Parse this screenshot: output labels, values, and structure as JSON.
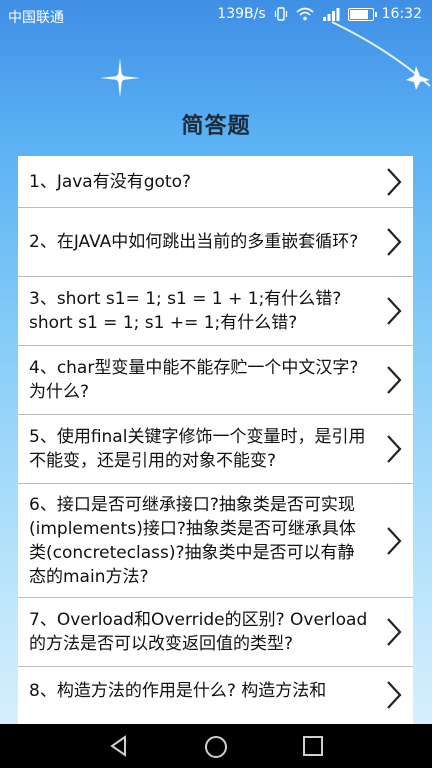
{
  "status_bar": {
    "carrier": "中国联通",
    "network_speed": "139B/s",
    "time": "16:32",
    "battery_level": 0.85,
    "icons": [
      "vibrate-icon",
      "wifi-icon",
      "signal-icon",
      "battery-icon"
    ]
  },
  "page": {
    "title": "简答题"
  },
  "questions": [
    {
      "text": "1、Java有没有goto?"
    },
    {
      "text": "2、在JAVA中如何跳出当前的多重嵌套循环?"
    },
    {
      "text": "3、short s1= 1; s1 = 1 + 1;有什么错? short s1 = 1; s1 += 1;有什么错?"
    },
    {
      "text": "4、char型变量中能不能存贮一个中文汉字?为什么?"
    },
    {
      "text": "5、使用final关键字修饰一个变量时，是引用不能变，还是引用的对象不能变?"
    },
    {
      "text": "6、接口是否可继承接口?抽象类是否可实现(implements)接口?抽象类是否可继承具体类(concreteclass)?抽象类中是否可以有静态的main方法?"
    },
    {
      "text": "7、Overload和Override的区别? Overload的方法是否可以改变返回值的类型?"
    },
    {
      "text": "8、构造方法的作用是什么? 构造方法和"
    }
  ],
  "nav_bar": {
    "icons": [
      "back-icon",
      "home-icon",
      "recents-icon"
    ]
  },
  "colors": {
    "list_bg": "#ffffff",
    "divider": "#bdbdbd",
    "title": "#1e2b38",
    "nav_bg": "#000000"
  }
}
